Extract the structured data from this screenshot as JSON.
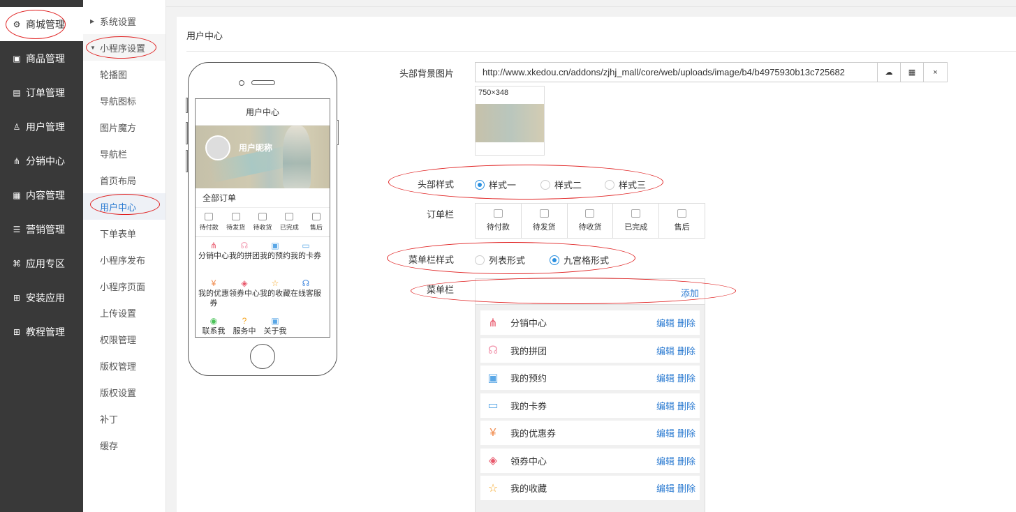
{
  "sidebar": {
    "items": [
      {
        "label": "商城管理",
        "icon": "gear-icon",
        "glyph": "⚙"
      },
      {
        "label": "商品管理",
        "icon": "bag-icon",
        "glyph": "▣"
      },
      {
        "label": "订单管理",
        "icon": "clipboard-icon",
        "glyph": "▤"
      },
      {
        "label": "用户管理",
        "icon": "user-icon",
        "glyph": "♙"
      },
      {
        "label": "分销中心",
        "icon": "network-icon",
        "glyph": "⋔"
      },
      {
        "label": "内容管理",
        "icon": "content-icon",
        "glyph": "▦"
      },
      {
        "label": "营销管理",
        "icon": "marketing-icon",
        "glyph": "☰"
      },
      {
        "label": "应用专区",
        "icon": "app-icon",
        "glyph": "⌘"
      },
      {
        "label": "安装应用",
        "icon": "grid-icon",
        "glyph": "⊞"
      },
      {
        "label": "教程管理",
        "icon": "grid-icon",
        "glyph": "⊞"
      }
    ]
  },
  "submenu": {
    "items": [
      {
        "label": "系统设置"
      },
      {
        "label": "小程序设置"
      },
      {
        "label": "轮播图"
      },
      {
        "label": "导航图标"
      },
      {
        "label": "图片魔方"
      },
      {
        "label": "导航栏"
      },
      {
        "label": "首页布局"
      },
      {
        "label": "用户中心"
      },
      {
        "label": "下单表单"
      },
      {
        "label": "小程序发布"
      },
      {
        "label": "小程序页面"
      },
      {
        "label": "上传设置"
      },
      {
        "label": "权限管理"
      },
      {
        "label": "版权管理"
      },
      {
        "label": "版权设置"
      },
      {
        "label": "补丁"
      },
      {
        "label": "缓存"
      }
    ]
  },
  "panel": {
    "title": "用户中心"
  },
  "phone": {
    "screen_title": "用户中心",
    "nickname": "用户昵称",
    "all_orders": "全部订单",
    "orders": [
      "待付款",
      "待发货",
      "待收货",
      "已完成",
      "售后"
    ],
    "grid": [
      {
        "label": "分销中心",
        "glyph": "⋔",
        "color": "#e8566a"
      },
      {
        "label": "我的拼团",
        "glyph": "☊",
        "color": "#f29ab0"
      },
      {
        "label": "我的预约",
        "glyph": "▣",
        "color": "#5aa7e6"
      },
      {
        "label": "我的卡券",
        "glyph": "▭",
        "color": "#5aa7e6"
      },
      {
        "label": "我的优惠券",
        "glyph": "¥",
        "color": "#f08a4b"
      },
      {
        "label": "领券中心",
        "glyph": "◈",
        "color": "#e8566a"
      },
      {
        "label": "我的收藏",
        "glyph": "☆",
        "color": "#f5a623"
      },
      {
        "label": "在线客服",
        "glyph": "☊",
        "color": "#4a8de0"
      },
      {
        "label": "联系我",
        "glyph": "◉",
        "color": "#4cc35a"
      },
      {
        "label": "服务中",
        "glyph": "?",
        "color": "#f5a623"
      },
      {
        "label": "关于我",
        "glyph": "▣",
        "color": "#5aa7e6"
      }
    ]
  },
  "form": {
    "header_bg": {
      "label": "头部背景图片",
      "value": "http://www.xkedou.cn/addons/zjhj_mall/core/web/uploads/image/b4/b4975930b13c725682",
      "upload_icon": "upload-cloud-icon",
      "grid_icon": "grid-icon",
      "close_label": "×",
      "thumb_size": "750×348"
    },
    "header_style": {
      "label": "头部样式",
      "options": [
        {
          "label": "样式一",
          "selected": true
        },
        {
          "label": "样式二",
          "selected": false
        },
        {
          "label": "样式三",
          "selected": false
        }
      ]
    },
    "order_bar": {
      "label": "订单栏",
      "items": [
        "待付款",
        "待发货",
        "待收货",
        "已完成",
        "售后"
      ]
    },
    "menu_style": {
      "label": "菜单栏样式",
      "options": [
        {
          "label": "列表形式",
          "selected": false
        },
        {
          "label": "九宫格形式",
          "selected": true
        }
      ]
    },
    "menu_bar": {
      "label": "菜单栏",
      "add_label": "添加",
      "edit_label": "编辑",
      "delete_label": "删除",
      "items": [
        {
          "label": "分销中心",
          "glyph": "⋔",
          "color": "#e8566a"
        },
        {
          "label": "我的拼团",
          "glyph": "☊",
          "color": "#f29ab0"
        },
        {
          "label": "我的预约",
          "glyph": "▣",
          "color": "#5aa7e6"
        },
        {
          "label": "我的卡券",
          "glyph": "▭",
          "color": "#5aa7e6"
        },
        {
          "label": "我的优惠券",
          "glyph": "¥",
          "color": "#f08a4b"
        },
        {
          "label": "领券中心",
          "glyph": "◈",
          "color": "#e8566a"
        },
        {
          "label": "我的收藏",
          "glyph": "☆",
          "color": "#f5a623"
        }
      ]
    }
  },
  "colors": {
    "accent": "#2a7ad1",
    "radio": "#2a8fdf",
    "sidebar": "#393939",
    "annotation": "#e02020"
  }
}
